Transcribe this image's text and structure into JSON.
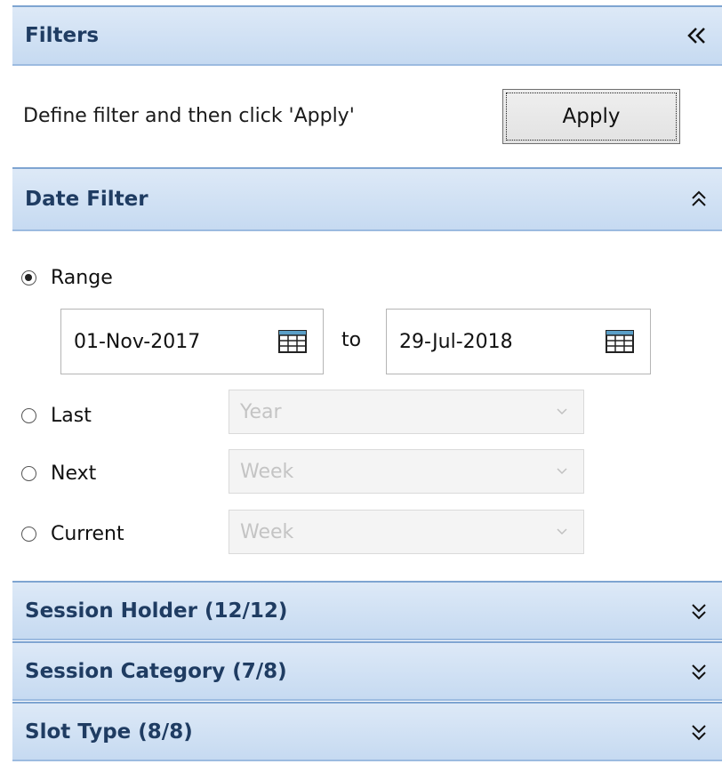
{
  "filters": {
    "title": "Filters",
    "intro_text": "Define filter and then click 'Apply'",
    "apply_label": "Apply"
  },
  "date_filter": {
    "title": "Date Filter",
    "range": {
      "label": "Range",
      "selected": true,
      "from_date": "01-Nov-2017",
      "to_label": "to",
      "to_date": "29-Jul-2018"
    },
    "options": [
      {
        "label": "Last",
        "value": "Year"
      },
      {
        "label": "Next",
        "value": "Week"
      },
      {
        "label": "Current",
        "value": "Week"
      }
    ]
  },
  "sections": [
    {
      "title": "Session Holder (12/12)"
    },
    {
      "title": "Session Category (7/8)"
    },
    {
      "title": "Slot Type (8/8)"
    }
  ],
  "colors": {
    "header_bg": "#c6daf1",
    "header_border": "#7ea4d1",
    "header_text": "#1f3c62"
  },
  "icons": {
    "collapse_panel": "double-chevron-left-icon",
    "collapse_section": "double-chevron-up-icon",
    "expand_section": "double-chevron-down-icon",
    "calendar": "calendar-icon",
    "dropdown": "chevron-down-icon"
  }
}
